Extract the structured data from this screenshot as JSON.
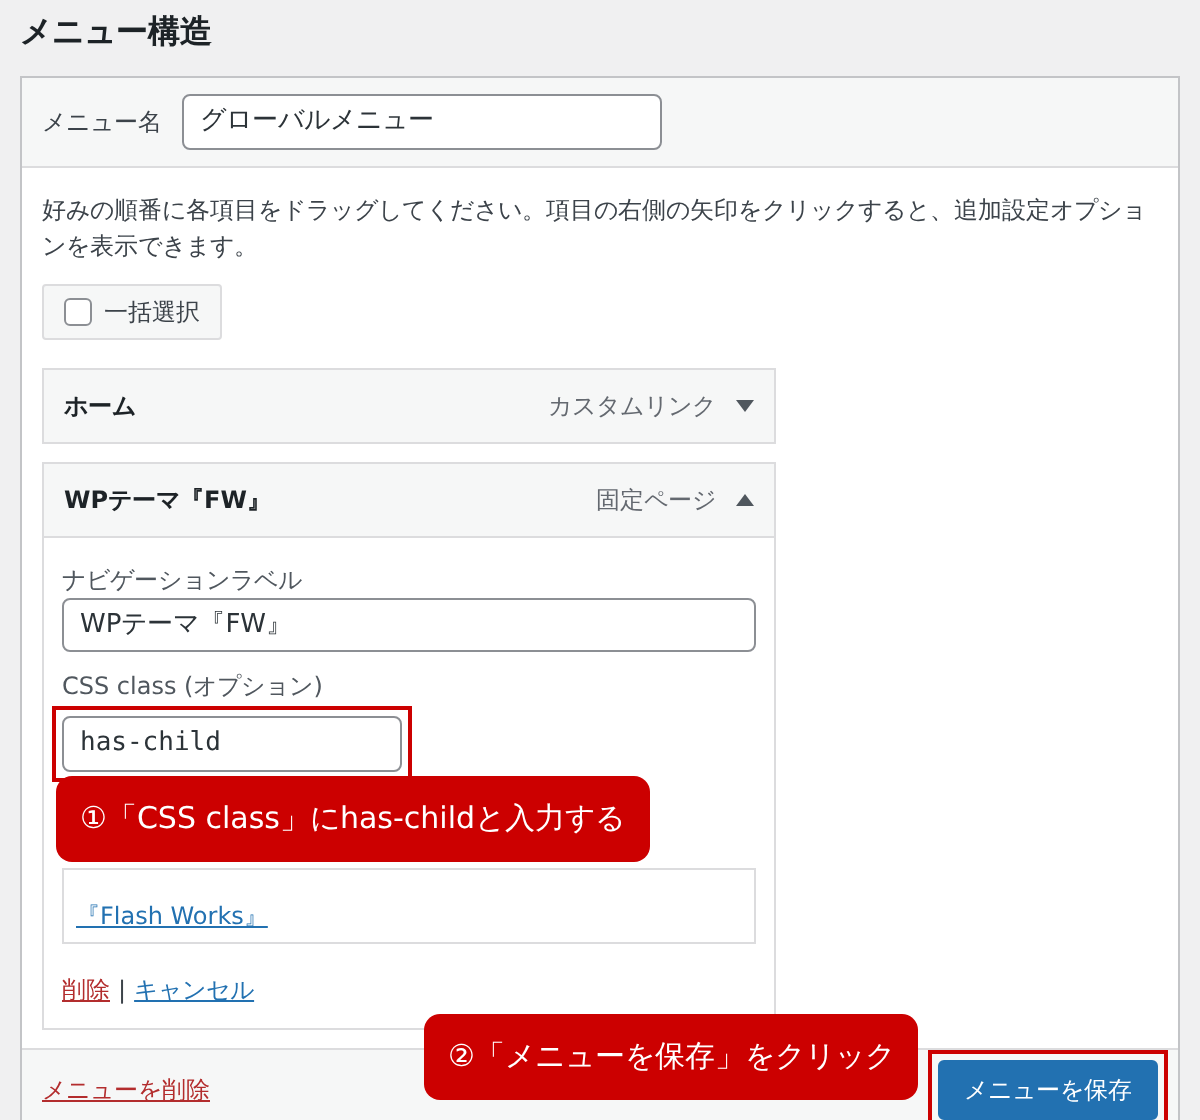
{
  "heading": "メニュー構造",
  "menu_name": {
    "label": "メニュー名",
    "value": "グローバルメニュー"
  },
  "instructions": "好みの順番に各項目をドラッグしてください。項目の右側の矢印をクリックすると、追加設定オプションを表示できます。",
  "bulk_select": {
    "label": "一括選択",
    "checked": false
  },
  "items": [
    {
      "title": "ホーム",
      "type_label": "カスタムリンク",
      "expanded": false
    },
    {
      "title": "WPテーマ『FW』",
      "type_label": "固定ページ",
      "expanded": true,
      "fields": [
        {
          "label": "ナビゲーションラベル",
          "value": "WPテーマ『FW』",
          "highlighted": false
        },
        {
          "label": "CSS class (オプション)",
          "value": "has-child",
          "highlighted": true
        }
      ],
      "original_link": "『Flash Works』",
      "actions": [
        "削除",
        "キャンセル"
      ],
      "action_separator": "|"
    }
  ],
  "delete_menu": "メニューを削除",
  "save_button": {
    "label": "メニューを保存",
    "highlighted": true
  },
  "callouts": [
    "①「CSS class」にhas-childと入力する",
    "②「メニューを保存」をクリック"
  ]
}
